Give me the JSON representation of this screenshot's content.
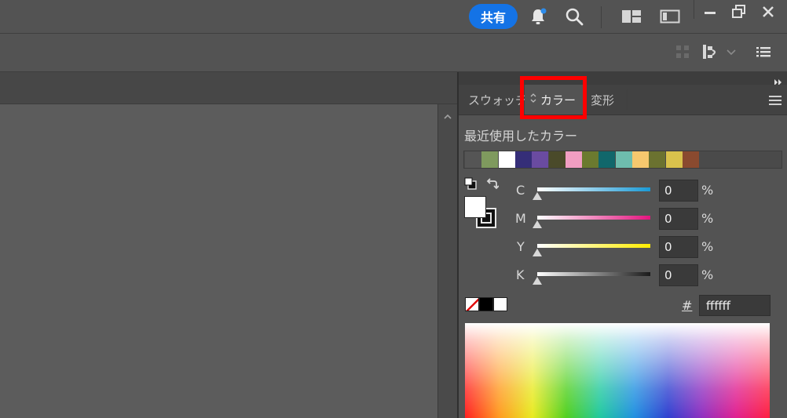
{
  "titlebar": {
    "share_label": "共有"
  },
  "panel": {
    "tabs": [
      {
        "label": "スウォッチ"
      },
      {
        "label": "カラー"
      },
      {
        "label": "変形"
      }
    ],
    "recent_colors_title": "最近使用したカラー",
    "recent_colors": [
      "#555555",
      "#7f9a5e",
      "#ffffff",
      "#352e78",
      "#6a4ba1",
      "#4a4a2a",
      "#f19ec2",
      "#6b7a2f",
      "#11676b",
      "#6ebdae",
      "#f6c86e",
      "#6b7230",
      "#d9c24c",
      "#8a4a2f"
    ],
    "sliders": [
      {
        "label": "C",
        "value": "0",
        "unit": "%",
        "gradient_end": "#1a9ad6"
      },
      {
        "label": "M",
        "value": "0",
        "unit": "%",
        "gradient_end": "#e4147f"
      },
      {
        "label": "Y",
        "value": "0",
        "unit": "%",
        "gradient_end": "#ffec00"
      },
      {
        "label": "K",
        "value": "0",
        "unit": "%",
        "gradient_end": "#1a1a1a"
      }
    ],
    "hex_symbol": "#",
    "hex_value": "ffffff"
  },
  "colors": {
    "accent": "#1473e6",
    "highlight": "#ff0000"
  }
}
